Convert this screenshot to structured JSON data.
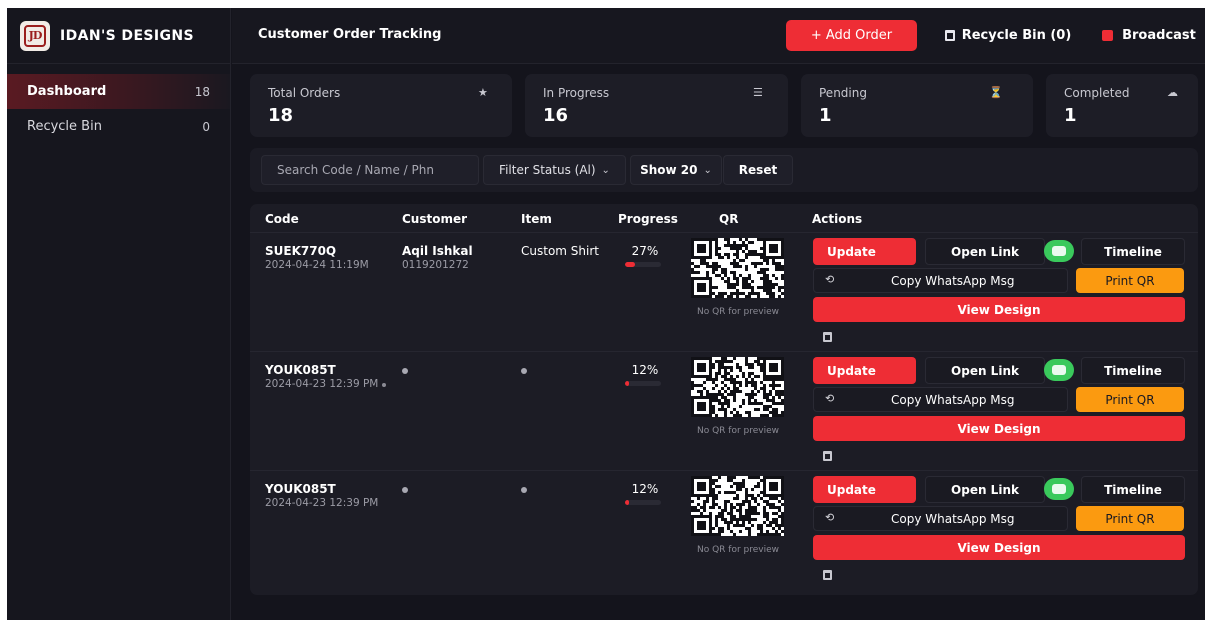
{
  "brand": {
    "name": "IDAN'S DESIGNS",
    "logo_text": "JD"
  },
  "sidebar": {
    "items": [
      {
        "label": "Dashboard",
        "count": "18"
      },
      {
        "label": "Recycle Bin",
        "count": "0"
      }
    ]
  },
  "header": {
    "title": "Customer Order Tracking",
    "add_order": "+ Add Order",
    "recycle_bin": "Recycle Bin (0)",
    "broadcast": "Broadcast"
  },
  "stats": [
    {
      "label": "Total Orders",
      "value": "18",
      "icon": "★"
    },
    {
      "label": "In Progress",
      "value": "16",
      "icon": "☰"
    },
    {
      "label": "Pending",
      "value": "1",
      "icon": "⏳"
    },
    {
      "label": "Completed",
      "value": "1",
      "icon": "☁"
    }
  ],
  "filters": {
    "search_placeholder": "Search Code / Name / Phn",
    "status": "Filter Status (Al)",
    "show": "Show 20",
    "reset": "Reset"
  },
  "table": {
    "columns": [
      "Code",
      "Customer",
      "Item",
      "Progress",
      "QR",
      "Actions"
    ],
    "rows": [
      {
        "code": "SUEK770Q",
        "date": "2024-04-24 11:19M",
        "customer": "Aqil Ishkal",
        "phone": "0119201272",
        "item": "Custom Shirt",
        "progress_label": "27%",
        "progress": 27,
        "qr_caption": "No QR for preview"
      },
      {
        "code": "YOUK085T",
        "date": "2024-04-23 12:39 PM",
        "customer": "",
        "phone": "",
        "item": "",
        "progress_label": "12%",
        "progress": 12,
        "qr_caption": "No QR for preview"
      },
      {
        "code": "YOUK085T",
        "date": "2024-04-23 12:39 PM",
        "customer": "",
        "phone": "",
        "item": "",
        "progress_label": "12%",
        "progress": 12,
        "qr_caption": "No QR for preview"
      }
    ]
  },
  "actions": {
    "update": "Update",
    "open_link": "Open Link",
    "timeline": "Timeline",
    "copy_whatsapp": "Copy WhatsApp Msg",
    "print_qr": "Print QR",
    "view_design": "View Design"
  },
  "colors": {
    "accent_red": "#ee2d35",
    "print_orange": "#fb9a10",
    "toggle_green": "#3ac95c",
    "background": "#14141c"
  },
  "icons": {
    "total_orders": "star-icon",
    "in_progress": "list-icon",
    "pending": "hourglass-icon",
    "completed": "cloud-icon",
    "copy": "copy-icon",
    "delete": "trash-icon"
  }
}
